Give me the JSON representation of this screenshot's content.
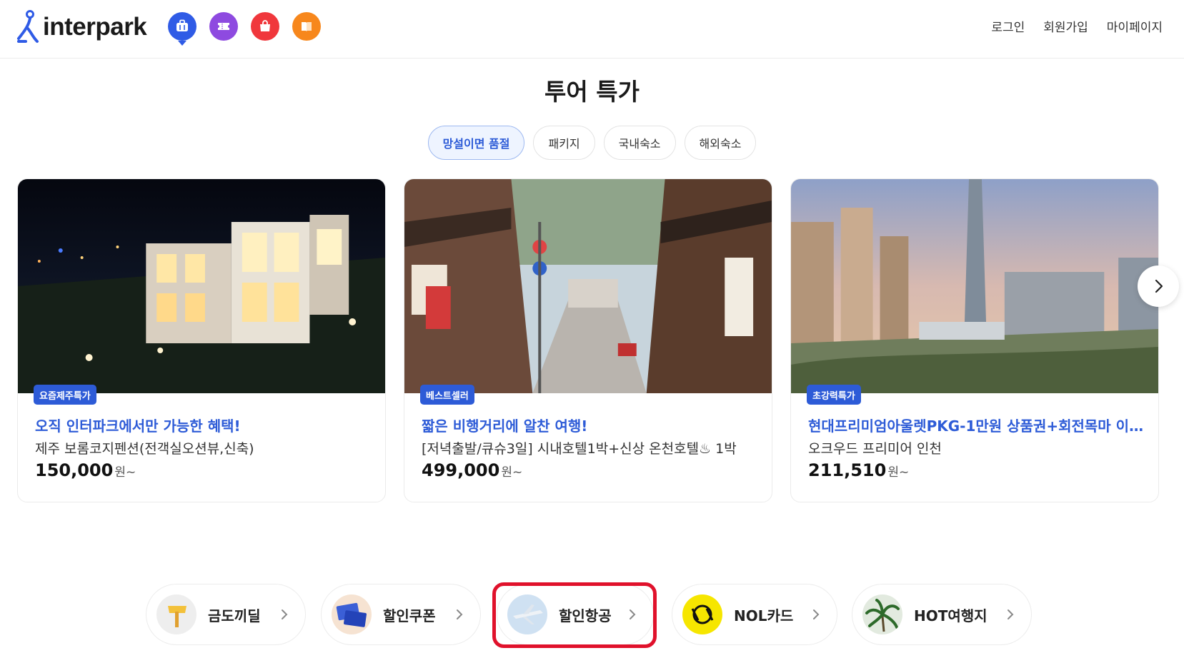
{
  "header": {
    "logo_text": "interpark",
    "nav": {
      "login": "로그인",
      "signup": "회원가입",
      "mypage": "마이페이지"
    },
    "service_icons": [
      "luggage-icon",
      "ticket-icon",
      "shopping-bag-icon",
      "book-icon"
    ]
  },
  "section": {
    "title": "투어 특가"
  },
  "tabs": [
    {
      "label": "망설이면 품절",
      "active": true
    },
    {
      "label": "패키지",
      "active": false
    },
    {
      "label": "국내숙소",
      "active": false
    },
    {
      "label": "해외숙소",
      "active": false
    }
  ],
  "cards": [
    {
      "badge": "요즘제주특가",
      "subtitle": "오직 인터파크에서만 가능한 혜택!",
      "name": "제주 보롬코지펜션(전객실오션뷰,신축)",
      "price": "150,000",
      "unit": "원~"
    },
    {
      "badge": "베스트셀러",
      "subtitle": "짧은 비행거리에 알찬 여행!",
      "name": "[저녁출발/큐슈3일] 시내호텔1박+신상 온천호텔♨ 1박",
      "price": "499,000",
      "unit": "원~"
    },
    {
      "badge": "초강력특가",
      "subtitle": "현대프리미엄아울렛PKG-1만원 상품권+회전목마 이...",
      "name": "오크우드 프리미어 인천",
      "price": "211,510",
      "unit": "원~"
    }
  ],
  "quick_links": [
    {
      "label": "금도끼딜"
    },
    {
      "label": "할인쿠폰"
    },
    {
      "label": "할인항공"
    },
    {
      "label": "NOL카드"
    },
    {
      "label": "HOT여행지"
    }
  ],
  "colors": {
    "accent": "#2d5bd7",
    "highlight": "#e0112b"
  }
}
